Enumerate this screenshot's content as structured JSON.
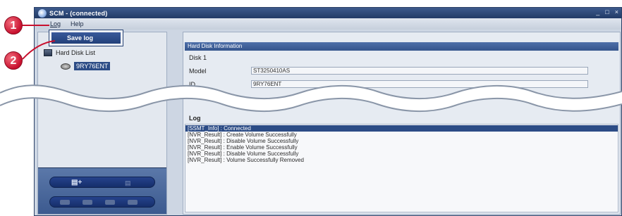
{
  "window": {
    "title": "SCM - (connected)",
    "controls": [
      "_",
      "□",
      "×"
    ]
  },
  "menubar": {
    "items": [
      {
        "label": "Log"
      },
      {
        "label": "Help"
      }
    ]
  },
  "dropdown": {
    "item": "Save log"
  },
  "left_pane": {
    "tree_root": "Hard Disk List",
    "tree_child": "9RY76ENT"
  },
  "right_pane": {
    "section_title": "Hard Disk Information",
    "disk_label": "Disk 1",
    "fields": [
      {
        "label": "Model",
        "value": "ST3250410AS"
      },
      {
        "label": "ID",
        "value": "9RY76ENT"
      }
    ],
    "log_title": "Log",
    "log_lines": [
      "[SSMT_Info] : Connected",
      "[NVR_Result] : Create Volume Successfully",
      "[NVR_Result] : Disable Volume Successfully",
      "[NVR_Result] : Enable Volume Successfully",
      "[NVR_Result] : Disable Volume Successfully",
      "[NVR_Result] : Volume Successfully Removed"
    ]
  },
  "callouts": [
    "1",
    "2"
  ],
  "colors": {
    "accent_blue": "#2c4c86",
    "callout_red": "#c8102e",
    "window_bg": "#cdd6e3"
  }
}
